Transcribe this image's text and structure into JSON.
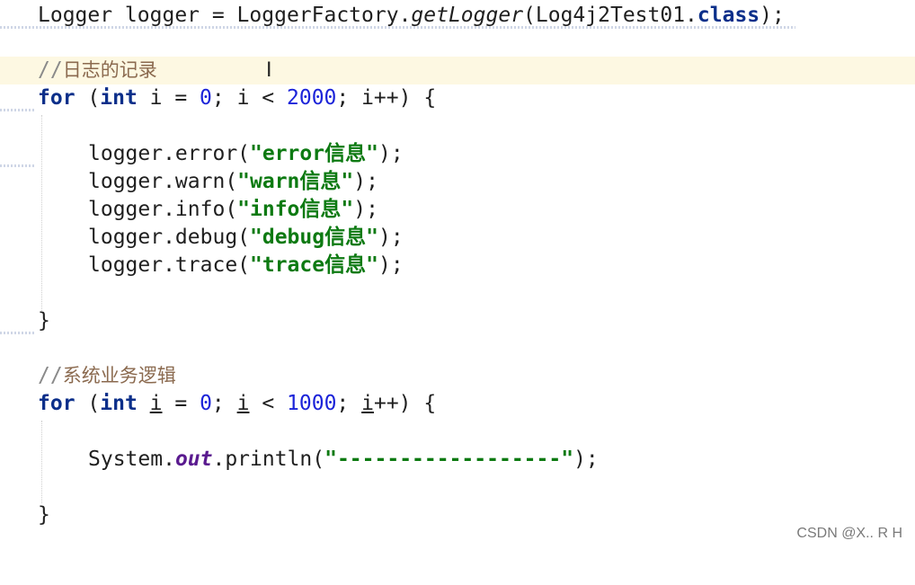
{
  "editor": {
    "lines": {
      "l1": {
        "p1": "Logger logger = LoggerFactory.",
        "p2": "getLogger",
        "p3": "(Log4j2Test01.",
        "p4": "class",
        "p5": ");"
      },
      "l2": {
        "slash": "//",
        "text": "日志的记录"
      },
      "l3": {
        "kw1": "for",
        "p1": " (",
        "kw2": "int",
        "p2": " i = ",
        "n1": "0",
        "p3": "; i < ",
        "n2": "2000",
        "p4": "; i++) {"
      },
      "l4": {
        "p1": "logger.error(",
        "s1": "\"error",
        "cjk": "信息",
        "s2": "\"",
        "p2": ");"
      },
      "l5": {
        "p1": "logger.warn(",
        "s1": "\"warn",
        "cjk": "信息",
        "s2": "\"",
        "p2": ");"
      },
      "l6": {
        "p1": "logger.info(",
        "s1": "\"info",
        "cjk": "信息",
        "s2": "\"",
        "p2": ");"
      },
      "l7": {
        "p1": "logger.debug(",
        "s1": "\"debug",
        "cjk": "信息",
        "s2": "\"",
        "p2": ");"
      },
      "l8": {
        "p1": "logger.trace(",
        "s1": "\"trace",
        "cjk": "信息",
        "s2": "\"",
        "p2": ");"
      },
      "l9": {
        "p1": "}"
      },
      "l10": {
        "slash": "//",
        "text": "系统业务逻辑"
      },
      "l11": {
        "kw1": "for",
        "p1": " (",
        "kw2": "int",
        "sp": " ",
        "v1": "i",
        "p2": " = ",
        "n1": "0",
        "p3": "; ",
        "v2": "i",
        "p4": " < ",
        "n2": "1000",
        "p5": "; ",
        "v3": "i",
        "p6": "++) {"
      },
      "l12": {
        "p1": "System.",
        "f1": "out",
        "p2": ".println(",
        "s1": "\"------------------\"",
        "p3": ");"
      },
      "l13": {
        "p1": "}"
      }
    },
    "colors": {
      "keyword": "#0b2f8a",
      "number": "#1c24d9",
      "string": "#0d7a12",
      "comment": "#8b6a4f",
      "current_line": "#fdf8e2"
    },
    "caret_icon": "text-cursor-icon"
  },
  "watermark": "CSDN @X.. R H"
}
